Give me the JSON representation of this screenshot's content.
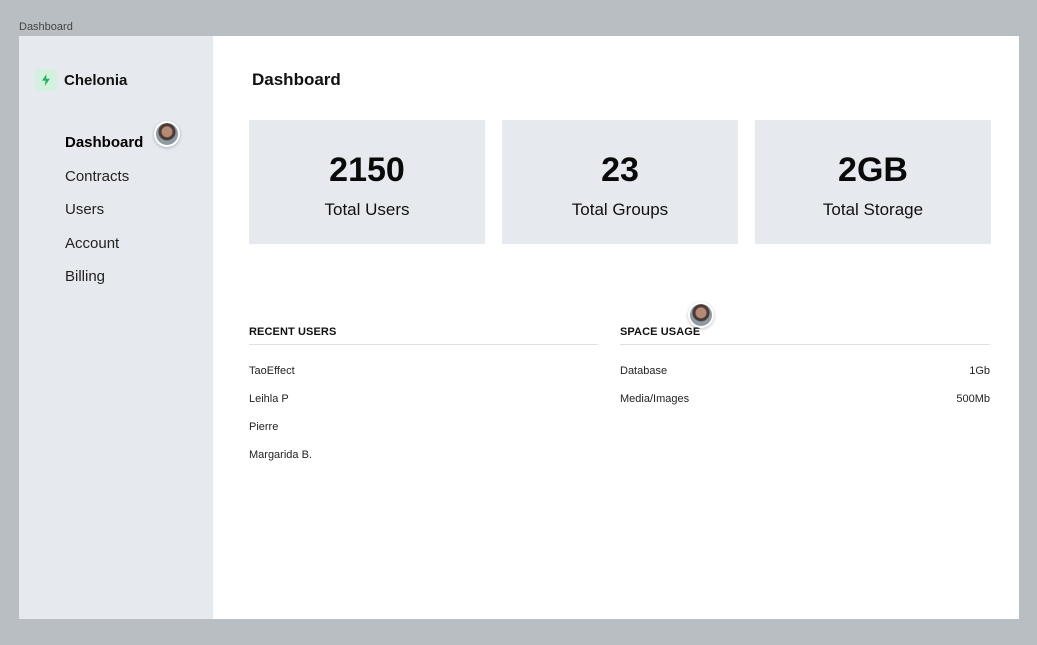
{
  "frame_label": "Dashboard",
  "brand": {
    "name": "Chelonia",
    "logo_icon": "lightning-bolt-icon",
    "logo_color": "#1fb05a"
  },
  "nav": {
    "items": [
      {
        "label": "Dashboard",
        "active": true
      },
      {
        "label": "Contracts"
      },
      {
        "label": "Users"
      },
      {
        "label": "Account"
      },
      {
        "label": "Billing"
      }
    ]
  },
  "page": {
    "title": "Dashboard"
  },
  "stats": [
    {
      "value": "2150",
      "label": "Total Users"
    },
    {
      "value": "23",
      "label": "Total Groups"
    },
    {
      "value": "2GB",
      "label": "Total Storage"
    }
  ],
  "recent_users": {
    "header": "RECENT USERS",
    "rows": [
      "TaoEffect",
      "Leihla P",
      "Pierre",
      "Margarida B."
    ]
  },
  "space_usage": {
    "header": "SPACE USAGE",
    "rows": [
      {
        "name": "Database",
        "value": "1Gb"
      },
      {
        "name": "Media/Images",
        "value": "500Mb"
      }
    ]
  },
  "colors": {
    "sidebar_bg": "#e6eaee",
    "card_bg": "#e6eaee",
    "canvas_bg": "#b8bec1",
    "accent": "#1fb05a"
  }
}
